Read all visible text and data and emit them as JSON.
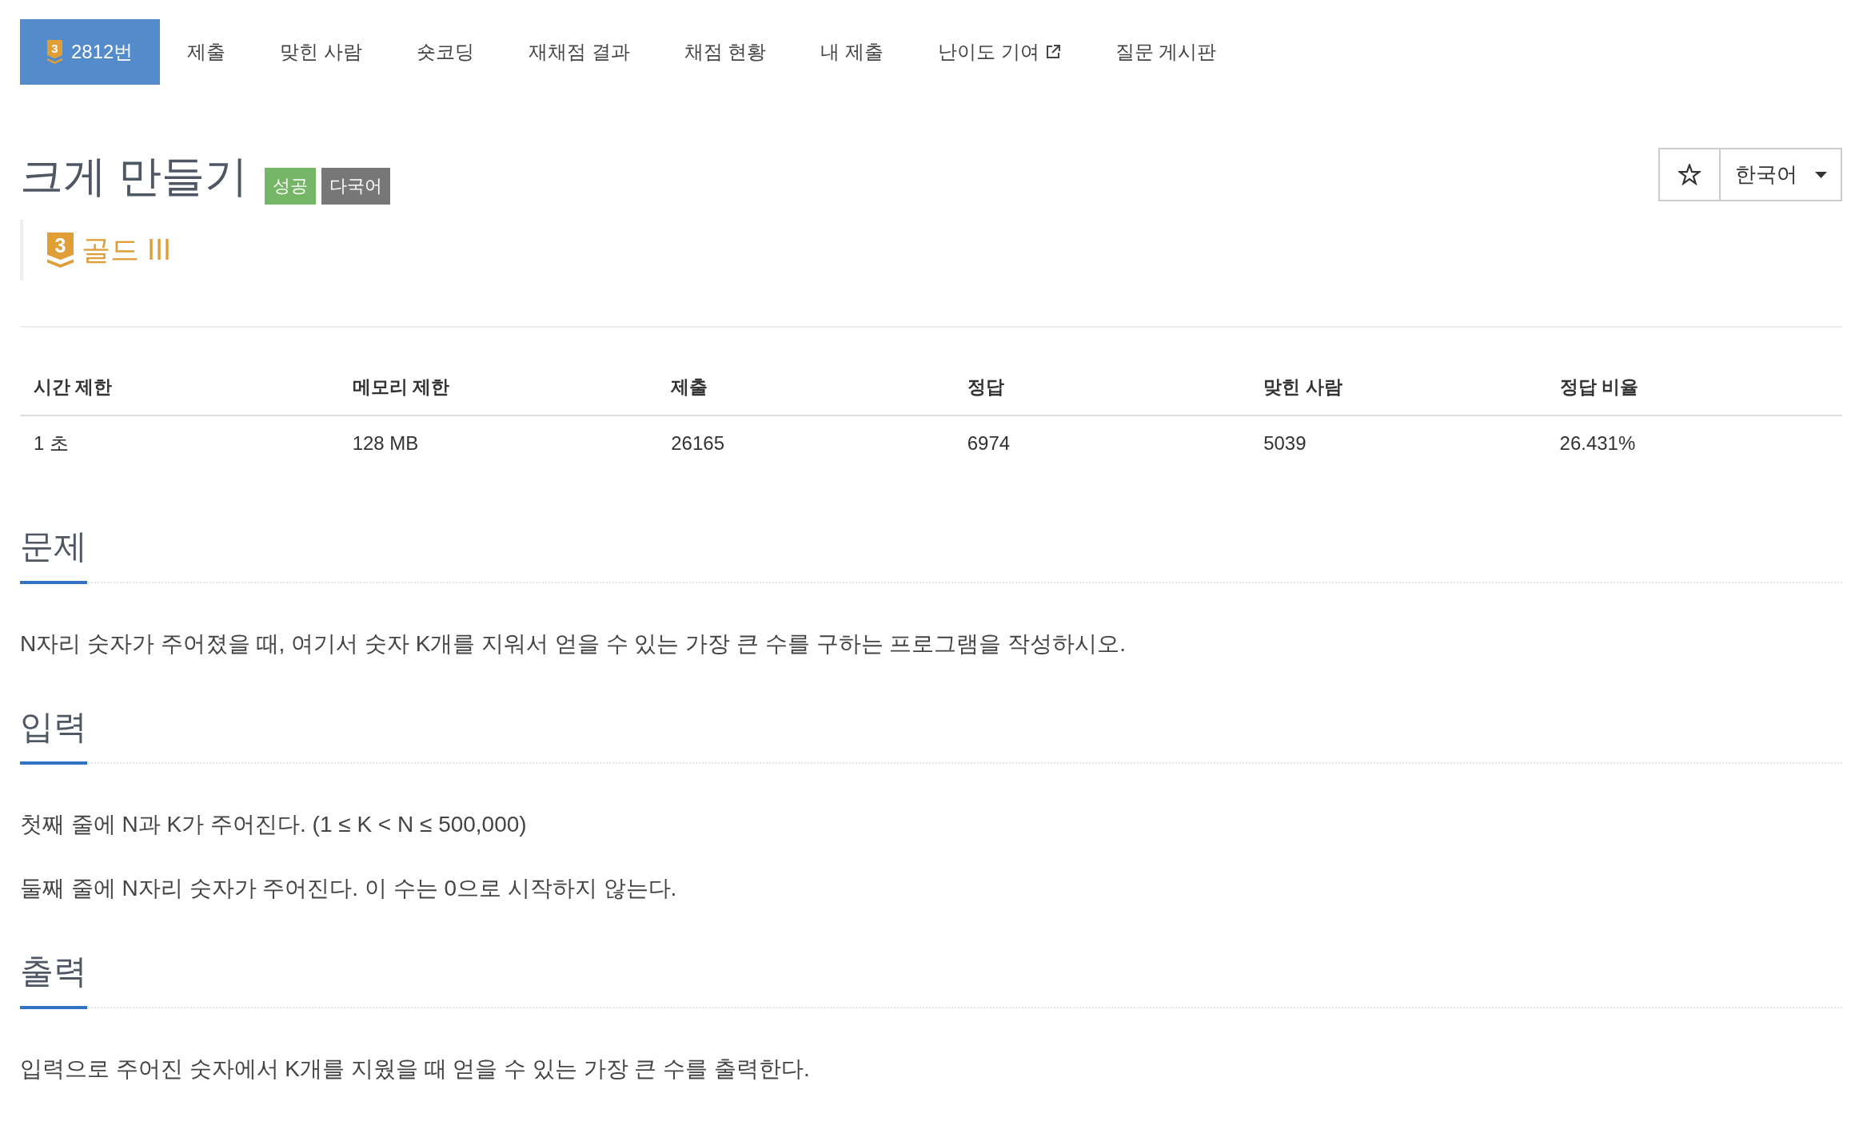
{
  "nav": {
    "tabs": [
      {
        "kind": "problem",
        "badge": "3",
        "label": "2812번",
        "selected": true
      },
      {
        "kind": "plain",
        "label": "제출",
        "selected": false
      },
      {
        "kind": "plain",
        "label": "맞힌 사람",
        "selected": false
      },
      {
        "kind": "plain",
        "label": "숏코딩",
        "selected": false
      },
      {
        "kind": "plain",
        "label": "재채점 결과",
        "selected": false
      },
      {
        "kind": "plain",
        "label": "채점 현황",
        "selected": false
      },
      {
        "kind": "plain",
        "label": "내 제출",
        "selected": false
      },
      {
        "kind": "external",
        "label": "난이도 기여",
        "selected": false
      },
      {
        "kind": "plain",
        "label": "질문 게시판",
        "selected": false
      }
    ]
  },
  "problem": {
    "title": "크게 만들기",
    "tags": [
      {
        "text": "성공",
        "color": "#74b566"
      },
      {
        "text": "다국어",
        "color": "#777777"
      }
    ],
    "tier": {
      "badge": "3",
      "name": "골드 III"
    }
  },
  "actions": {
    "starred": false,
    "language": {
      "value": "한국어"
    }
  },
  "info_table": {
    "columns": [
      "시간 제한",
      "메모리 제한",
      "제출",
      "정답",
      "맞힌 사람",
      "정답 비율"
    ],
    "rows": [
      [
        "1 초",
        "128 MB",
        "26165",
        "6974",
        "5039",
        "26.431%"
      ]
    ]
  },
  "sections": [
    {
      "heading": "문제",
      "paragraphs": [
        "N자리 숫자가 주어졌을 때, 여기서 숫자 K개를 지워서 얻을 수 있는 가장 큰 수를 구하는 프로그램을 작성하시오."
      ]
    },
    {
      "heading": "입력",
      "paragraphs": [
        "첫째 줄에 N과 K가 주어진다. (1 ≤ K < N ≤ 500,000)",
        "둘째 줄에 N자리 숫자가 주어진다. 이 수는 0으로 시작하지 않는다."
      ]
    },
    {
      "heading": "출력",
      "paragraphs": [
        "입력으로 주어진 숫자에서 K개를 지웠을 때 얻을 수 있는 가장 큰 수를 출력한다."
      ]
    }
  ]
}
